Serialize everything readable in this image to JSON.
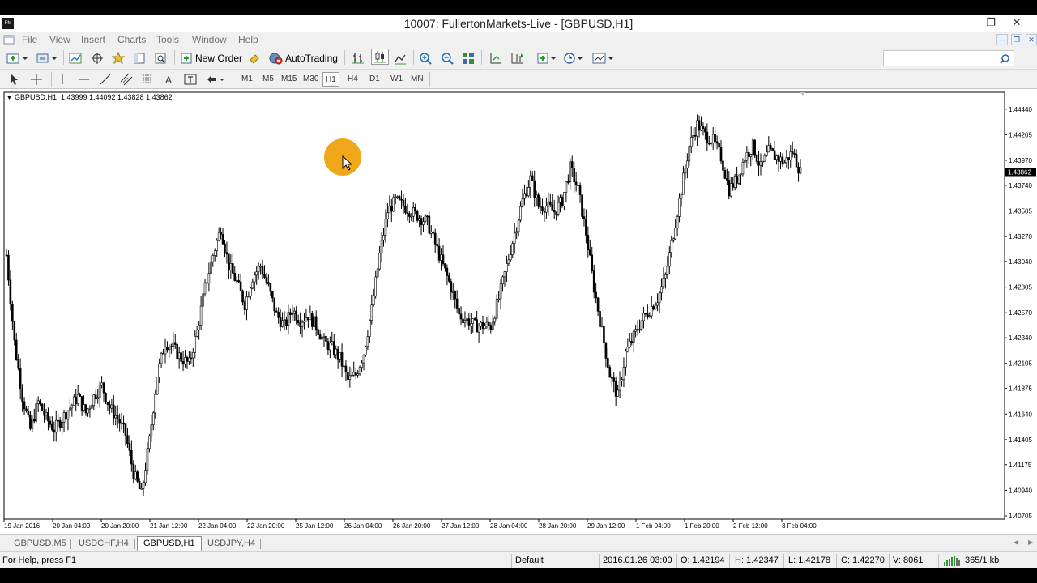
{
  "window": {
    "title": "10007: FullertonMarkets-Live - [GBPUSD,H1]",
    "app_icon_text": "FM",
    "minimize": "—",
    "restore": "❐",
    "close": "✕"
  },
  "menu": {
    "items": [
      "File",
      "View",
      "Insert",
      "Charts",
      "Tools",
      "Window",
      "Help"
    ],
    "mdi_buttons": [
      "–",
      "❐",
      "✕"
    ]
  },
  "toolbar": {
    "new_order_label": "New Order",
    "autotrading_label": "AutoTrading",
    "search_placeholder": ""
  },
  "timeframes": [
    "M1",
    "M5",
    "M15",
    "M30",
    "H1",
    "H4",
    "D1",
    "W1",
    "MN"
  ],
  "active_timeframe": "H1",
  "chart": {
    "header_symbol": "GBPUSD,H1",
    "header_values": "1.43999 1.44092 1.43828 1.43862",
    "current_price": "1.43862",
    "price_labels": [
      "1.44440",
      "1.44205",
      "1.43970",
      "1.43740",
      "1.43505",
      "1.43270",
      "1.43040",
      "1.42805",
      "1.42570",
      "1.42340",
      "1.42105",
      "1.41875",
      "1.41640",
      "1.41405",
      "1.41175",
      "1.40940",
      "1.40705"
    ],
    "time_labels": [
      "19 Jan 2016",
      "20 Jan 04:00",
      "20 Jan 20:00",
      "21 Jan 12:00",
      "22 Jan 04:00",
      "22 Jan 20:00",
      "25 Jan 12:00",
      "26 Jan 04:00",
      "26 Jan 20:00",
      "27 Jan 12:00",
      "28 Jan 04:00",
      "28 Jan 20:00",
      "29 Jan 12:00",
      "1 Feb 04:00",
      "1 Feb 20:00",
      "2 Feb 12:00",
      "3 Feb 04:00"
    ],
    "colors": {
      "background": "#ffffff",
      "candle": "#000000",
      "price_line": "#c0c0c0"
    }
  },
  "chart_data": {
    "type": "candlestick",
    "symbol": "GBPUSD",
    "timeframe": "H1",
    "ylim": [
      1.40705,
      1.4452
    ],
    "last_close": 1.43862,
    "last_bar": {
      "open": 1.43999,
      "high": 1.44092,
      "low": 1.43828,
      "close": 1.43862
    },
    "x_tick_labels": [
      "19 Jan 2016",
      "20 Jan 04:00",
      "20 Jan 20:00",
      "21 Jan 12:00",
      "22 Jan 04:00",
      "22 Jan 20:00",
      "25 Jan 12:00",
      "26 Jan 04:00",
      "26 Jan 20:00",
      "27 Jan 12:00",
      "28 Jan 04:00",
      "28 Jan 20:00",
      "29 Jan 12:00",
      "1 Feb 04:00",
      "1 Feb 20:00",
      "2 Feb 12:00",
      "3 Feb 04:00"
    ],
    "y_tick_labels": [
      1.4444,
      1.44205,
      1.4397,
      1.4374,
      1.43505,
      1.4327,
      1.4304,
      1.42805,
      1.4257,
      1.4234,
      1.42105,
      1.41875,
      1.4164,
      1.41405,
      1.41175,
      1.4094,
      1.40705
    ],
    "close_path": [
      [
        0,
        1.431
      ],
      [
        4,
        1.423
      ],
      [
        8,
        1.418
      ],
      [
        12,
        1.415
      ],
      [
        16,
        1.4175
      ],
      [
        20,
        1.416
      ],
      [
        24,
        1.415
      ],
      [
        28,
        1.416
      ],
      [
        32,
        1.417
      ],
      [
        36,
        1.418
      ],
      [
        40,
        1.4165
      ],
      [
        44,
        1.418
      ],
      [
        48,
        1.419
      ],
      [
        52,
        1.417
      ],
      [
        56,
        1.416
      ],
      [
        60,
        1.4145
      ],
      [
        64,
        1.411
      ],
      [
        68,
        1.409
      ],
      [
        72,
        1.414
      ],
      [
        76,
        1.42
      ],
      [
        80,
        1.423
      ],
      [
        84,
        1.4225
      ],
      [
        88,
        1.4215
      ],
      [
        92,
        1.421
      ],
      [
        96,
        1.424
      ],
      [
        100,
        1.428
      ],
      [
        104,
        1.431
      ],
      [
        108,
        1.4335
      ],
      [
        112,
        1.43
      ],
      [
        116,
        1.4285
      ],
      [
        120,
        1.4265
      ],
      [
        124,
        1.429
      ],
      [
        128,
        1.43
      ],
      [
        132,
        1.428
      ],
      [
        136,
        1.4255
      ],
      [
        140,
        1.4245
      ],
      [
        144,
        1.426
      ],
      [
        148,
        1.425
      ],
      [
        152,
        1.4255
      ],
      [
        156,
        1.4245
      ],
      [
        160,
        1.423
      ],
      [
        164,
        1.4225
      ],
      [
        168,
        1.4215
      ],
      [
        172,
        1.4195
      ],
      [
        176,
        1.42
      ],
      [
        180,
        1.422
      ],
      [
        184,
        1.426
      ],
      [
        188,
        1.431
      ],
      [
        192,
        1.435
      ],
      [
        196,
        1.436
      ],
      [
        200,
        1.4355
      ],
      [
        204,
        1.435
      ],
      [
        208,
        1.4345
      ],
      [
        212,
        1.434
      ],
      [
        216,
        1.432
      ],
      [
        220,
        1.43
      ],
      [
        224,
        1.428
      ],
      [
        228,
        1.4255
      ],
      [
        232,
        1.425
      ],
      [
        236,
        1.4245
      ],
      [
        240,
        1.4245
      ],
      [
        244,
        1.4245
      ],
      [
        248,
        1.427
      ],
      [
        252,
        1.43
      ],
      [
        256,
        1.433
      ],
      [
        260,
        1.436
      ],
      [
        264,
        1.438
      ],
      [
        268,
        1.4355
      ],
      [
        272,
        1.4355
      ],
      [
        276,
        1.435
      ],
      [
        280,
        1.436
      ],
      [
        284,
        1.439
      ],
      [
        288,
        1.437
      ],
      [
        292,
        1.433
      ],
      [
        296,
        1.428
      ],
      [
        300,
        1.424
      ],
      [
        304,
        1.42
      ],
      [
        308,
        1.418
      ],
      [
        312,
        1.422
      ],
      [
        316,
        1.4235
      ],
      [
        320,
        1.425
      ],
      [
        324,
        1.426
      ],
      [
        328,
        1.427
      ],
      [
        332,
        1.429
      ],
      [
        336,
        1.433
      ],
      [
        340,
        1.437
      ],
      [
        344,
        1.441
      ],
      [
        348,
        1.443
      ],
      [
        352,
        1.442
      ],
      [
        356,
        1.4415
      ],
      [
        360,
        1.44
      ],
      [
        364,
        1.437
      ],
      [
        368,
        1.438
      ],
      [
        372,
        1.44
      ],
      [
        376,
        1.441
      ],
      [
        380,
        1.439
      ],
      [
        384,
        1.4405
      ],
      [
        388,
        1.44
      ],
      [
        392,
        1.4395
      ],
      [
        396,
        1.4405
      ],
      [
        400,
        1.4386
      ]
    ]
  },
  "tabs": {
    "items": [
      "GBPUSD,M5",
      "USDCHF,H4",
      "GBPUSD,H1",
      "USDJPY,H4"
    ],
    "active": "GBPUSD,H1"
  },
  "status": {
    "help": "For Help, press F1",
    "profile": "Default",
    "datetime": "2016.01.26 03:00",
    "open": "O: 1.42194",
    "high": "H: 1.42347",
    "low": "L: 1.42178",
    "close": "C: 1.42270",
    "volume": "V: 8061",
    "traffic": "365/1 kb"
  }
}
